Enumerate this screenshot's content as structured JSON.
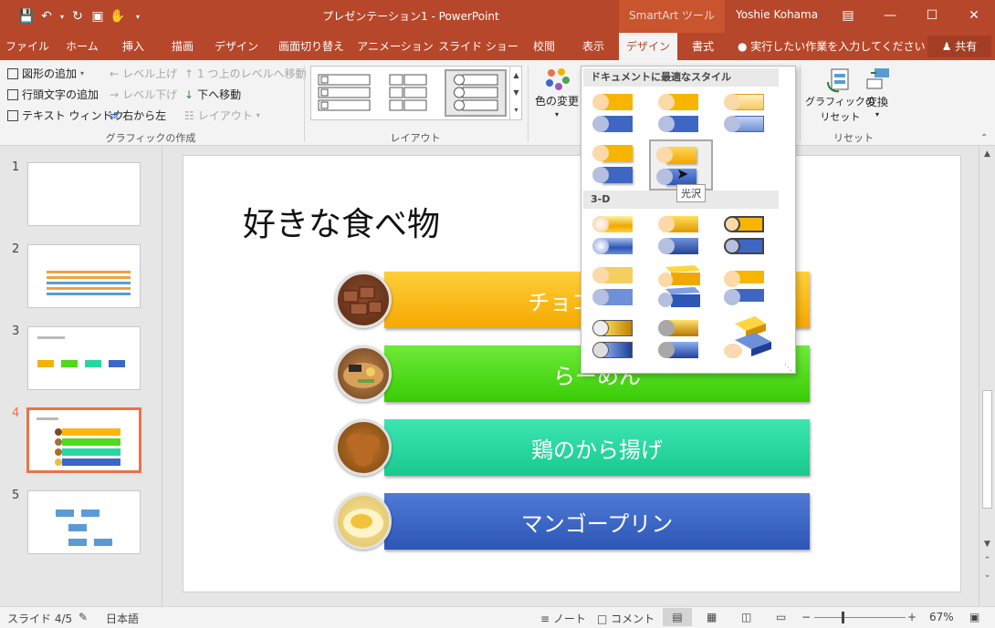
{
  "window": {
    "title": "プレゼンテーション1 - PowerPoint",
    "context_tools": "SmartArt ツール",
    "user": "Yoshie Kohama"
  },
  "tabs": [
    {
      "label": "ファイル"
    },
    {
      "label": "ホーム"
    },
    {
      "label": "挿入"
    },
    {
      "label": "描画"
    },
    {
      "label": "デザイン"
    },
    {
      "label": "画面切り替え"
    },
    {
      "label": "アニメーション"
    },
    {
      "label": "スライド ショー"
    },
    {
      "label": "校閲"
    },
    {
      "label": "表示"
    },
    {
      "label": "デザイン"
    },
    {
      "label": "書式"
    }
  ],
  "tell_me": "実行したい作業を入力してください",
  "share": "共有",
  "ribbon": {
    "create_graphic": {
      "add_shape": "図形の追加",
      "add_bullet": "行頭文字の追加",
      "text_pane": "テキスト ウィンドウ",
      "promote": "レベル上げ",
      "demote": "レベル下げ",
      "right_to_left": "右から左",
      "move_up": "1 つ上のレベルへ移動",
      "move_down": "下へ移動",
      "layout": "レイアウト",
      "label": "グラフィックの作成"
    },
    "layouts_label": "レイアウト",
    "change_colors": "色の変更",
    "reset": {
      "reset_graphic_1": "グラフィックの",
      "reset_graphic_2": "リセット",
      "convert": "変換",
      "label": "リセット"
    }
  },
  "style_pane": {
    "heading_best": "ドキュメントに最適なスタイル",
    "heading_3d": "3-D",
    "tooltip": "光沢"
  },
  "thumbnails": [
    {
      "number": "1"
    },
    {
      "number": "2"
    },
    {
      "number": "3"
    },
    {
      "number": "4"
    },
    {
      "number": "5"
    }
  ],
  "slide": {
    "title": "好きな食べ物",
    "items": [
      {
        "label": "チョコ"
      },
      {
        "label": "らーめん"
      },
      {
        "label": "鶏のから揚げ"
      },
      {
        "label": "マンゴープリン"
      }
    ],
    "colors": {
      "choco": "#fbb60f",
      "ramen": "#4fd91f",
      "karaage": "#26d8a0",
      "mango": "#3a67c9"
    }
  },
  "status": {
    "slide_info": "スライド 4/5",
    "language": "日本語",
    "notes": "ノート",
    "comments": "コメント",
    "zoom": "67%"
  }
}
